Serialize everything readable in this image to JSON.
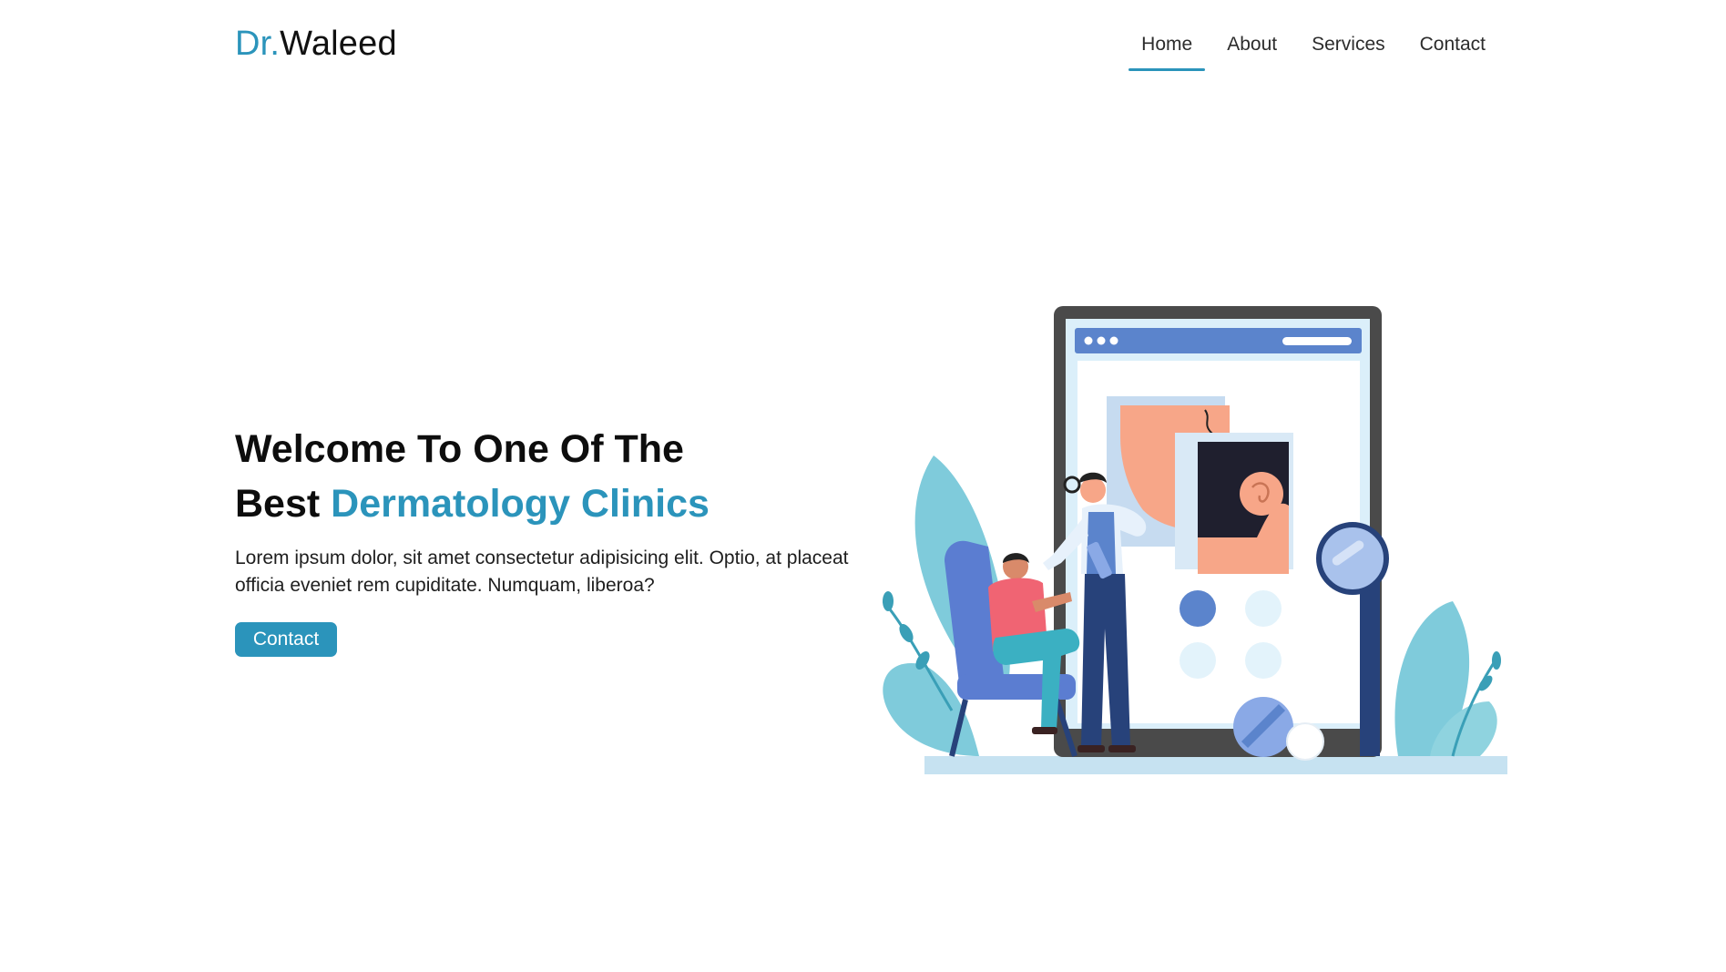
{
  "header": {
    "logo": {
      "accent": "Dr.",
      "main": "Waleed"
    },
    "nav": [
      {
        "label": "Home",
        "active": true
      },
      {
        "label": "About",
        "active": false
      },
      {
        "label": "Services",
        "active": false
      },
      {
        "label": "Contact",
        "active": false
      }
    ]
  },
  "hero": {
    "title_line1": "Welcome To One Of The",
    "title_line2_prefix": "Best ",
    "title_line2_accent": "Dermatology Clinics",
    "description": "Lorem ipsum dolor, sit amet consectetur adipisicing elit. Optio, at placeat officia eveniet rem cupiditate. Numquam, liberoa?",
    "cta_label": "Contact"
  },
  "illustration": {
    "icon": "dermatology-consultation-illustration"
  },
  "colors": {
    "accent": "#2b94bb",
    "text": "#111111",
    "background": "#ffffff"
  }
}
